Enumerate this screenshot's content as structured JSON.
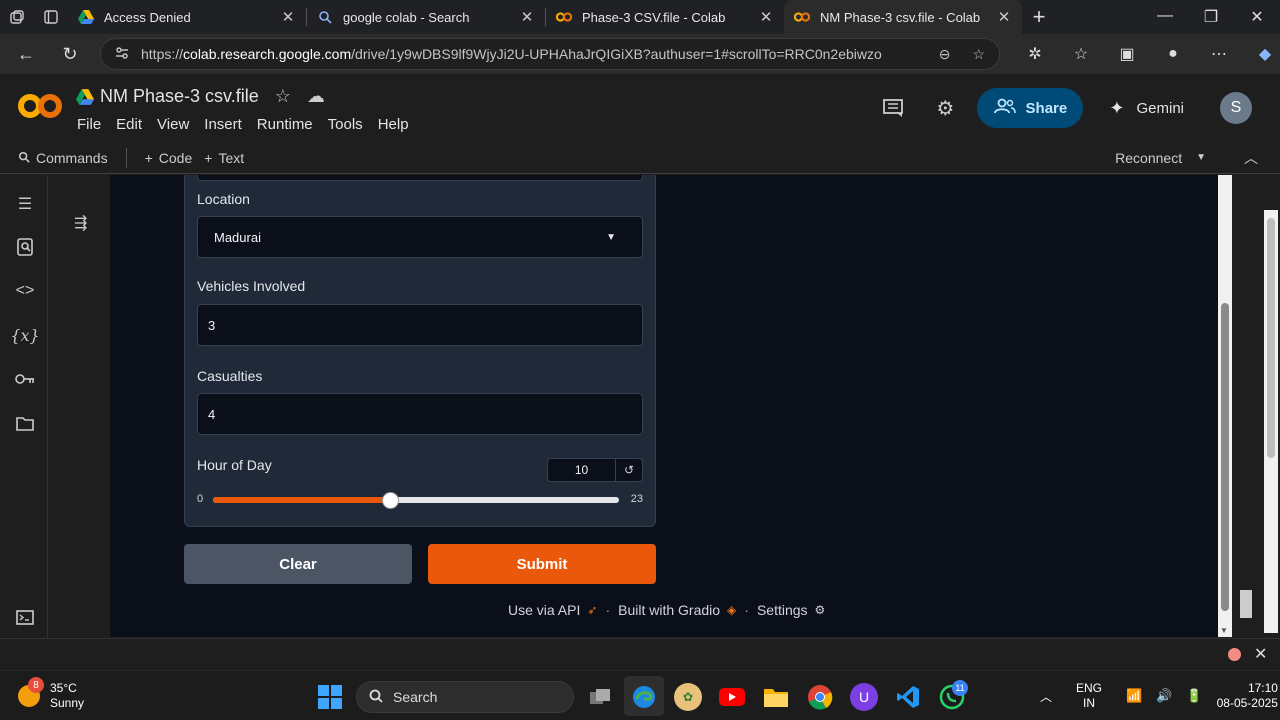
{
  "browser": {
    "tabs": [
      {
        "title": "Access Denied",
        "icon": "google-drive-icon",
        "active": false
      },
      {
        "title": "google colab - Search",
        "icon": "search-icon",
        "active": false
      },
      {
        "title": "Phase-3 CSV.file - Colab",
        "icon": "colab-icon",
        "active": false
      },
      {
        "title": "NM Phase-3 csv.file - Colab",
        "icon": "colab-icon",
        "active": true
      }
    ],
    "url_prefix": "https://",
    "url_host": "colab.research.google.com",
    "url_path": "/drive/1y9wDBS9lf9WjyJi2U-UPHAhaJrQIGiXB?authuser=1#scrollTo=RRC0n2ebiwzo"
  },
  "colab": {
    "notebook_title": "NM Phase-3 csv.file",
    "menu": [
      "File",
      "Edit",
      "View",
      "Insert",
      "Runtime",
      "Tools",
      "Help"
    ],
    "share_label": "Share",
    "gemini_label": "Gemini",
    "avatar_initial": "S",
    "toolbar": {
      "commands": "Commands",
      "code": "Code",
      "text": "Text",
      "reconnect": "Reconnect"
    }
  },
  "form": {
    "location_label": "Location",
    "location_value": "Madurai",
    "vehicles_label": "Vehicles Involved",
    "vehicles_value": "3",
    "casualties_label": "Casualties",
    "casualties_value": "4",
    "hour_label": "Hour of Day",
    "hour_value": "10",
    "hour_min": "0",
    "hour_max": "23",
    "hour_fraction": 0.4348,
    "clear_label": "Clear",
    "submit_label": "Submit",
    "accent_color": "#ea580c"
  },
  "footer": {
    "api": "Use via API",
    "gradio": "Built with Gradio",
    "settings": "Settings"
  },
  "taskbar": {
    "weather_temp": "35°C",
    "weather_desc": "Sunny",
    "weather_badge": "8",
    "search_label": "Search",
    "whatsapp_badge": "11",
    "lang_1": "ENG",
    "lang_2": "IN",
    "time": "17:10",
    "date": "08-05-2025"
  }
}
